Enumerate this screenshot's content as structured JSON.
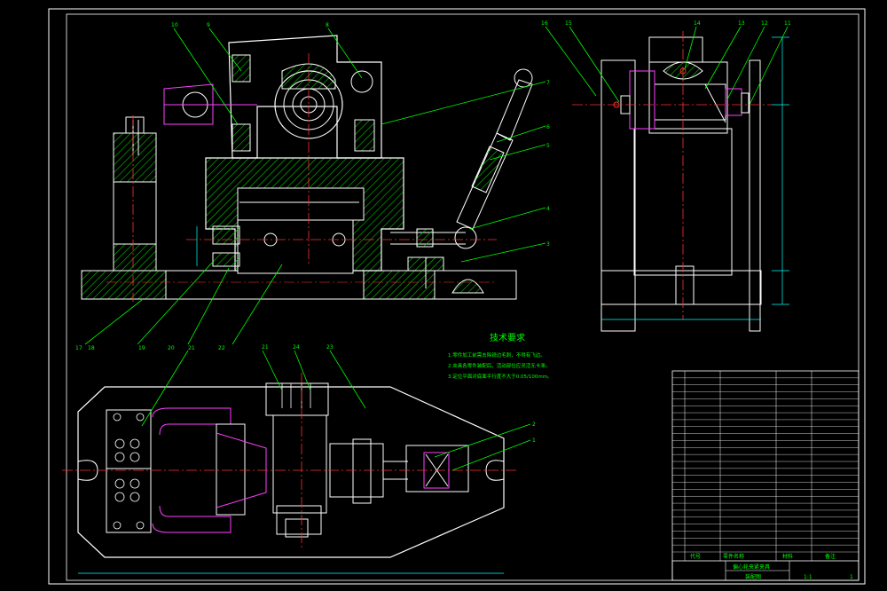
{
  "drawing": {
    "notes_title": "技术要求",
    "notes": [
      "1.零件加工前需去除锐边毛刺，不得有飞边。",
      "2.夹具各零件装配后，活动部位应灵活无卡滞。",
      "3.定位平面对底面平行度不大于0.05/100mm。"
    ],
    "title_block": {
      "drawing_name": "偏心轮夹紧夹具",
      "sheet_name": "装配图",
      "scale": "1:1",
      "col_part_no": "代号",
      "col_part_name": "零件名称",
      "col_material": "材料",
      "col_remark": "备注",
      "sheet_of": "1"
    },
    "balloons": {
      "front": [
        "10",
        "9",
        "8",
        "7",
        "6",
        "5",
        "4",
        "3",
        "17",
        "18",
        "19",
        "20",
        "21",
        "22"
      ],
      "side": [
        "16",
        "15",
        "14",
        "13",
        "12",
        "11"
      ],
      "top": [
        "21",
        "24",
        "23",
        "2",
        "1"
      ]
    },
    "bom_rows": 26
  },
  "colors": {
    "background": "#000000",
    "outline": "#ffffff",
    "leader": "#00ff00",
    "hatch": "#00c800",
    "center": "#ff3030",
    "magenta": "#ff40ff",
    "dimension": "#00ffff",
    "frame": "#ffffff"
  }
}
